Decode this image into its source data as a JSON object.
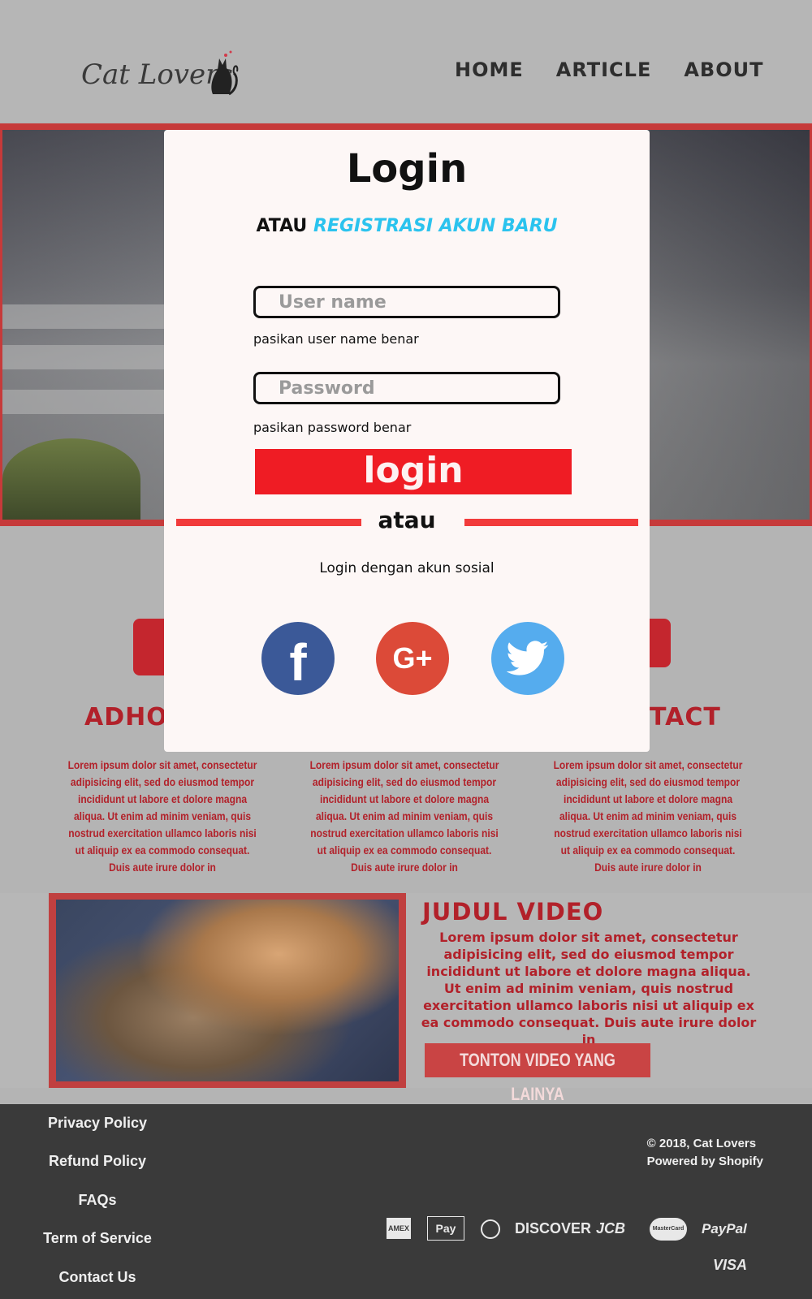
{
  "header": {
    "logo_text": "Cat Lovers",
    "nav": [
      {
        "label": "HOME"
      },
      {
        "label": "ARTICLE"
      },
      {
        "label": "ABOUT"
      }
    ]
  },
  "features": [
    {
      "title": "ADHOP",
      "icon": "github-icon",
      "text": "Lorem ipsum dolor sit amet, consectetur adipisicing elit, sed do eiusmod tempor incididunt ut labore et dolore magna aliqua. Ut enim ad minim veniam, quis nostrud exercitation ullamco laboris nisi ut aliquip ex ea commodo consequat. Duis aute irure dolor in"
    },
    {
      "text": "Lorem ipsum dolor sit amet, consectetur adipisicing elit, sed do eiusmod tempor incididunt ut labore et dolore magna aliqua. Ut enim ad minim veniam, quis nostrud exercitation ullamco laboris nisi ut aliquip ex ea commodo consequat. Duis aute irure dolor in"
    },
    {
      "title": "TACT",
      "icon": "phone-24-icon",
      "text": "Lorem ipsum dolor sit amet, consectetur adipisicing elit, sed do eiusmod tempor incididunt ut labore et dolore magna aliqua. Ut enim ad minim veniam, quis nostrud exercitation ullamco laboris nisi ut aliquip ex ea commodo consequat. Duis aute irure dolor in"
    }
  ],
  "video": {
    "title": "JUDUL VIDEO",
    "text": "Lorem ipsum dolor sit amet, consectetur adipisicing elit, sed do eiusmod tempor incididunt ut labore et dolore magna aliqua. Ut enim ad minim veniam, quis nostrud exercitation ullamco laboris nisi ut aliquip ex ea commodo consequat. Duis aute irure dolor in",
    "button_label": "TONTON VIDEO YANG LAINYA"
  },
  "footer": {
    "links": [
      "Privacy Policy",
      "Refund Policy",
      "FAQs",
      "Term of Service",
      "Contact Us"
    ],
    "copyright": "© 2018, Cat Lovers",
    "powered": "Powered by Shopify",
    "payments": [
      "AMEX",
      "Pay",
      "DISCOVER",
      "JCB",
      "MasterCard",
      "PayPal",
      "VISA"
    ]
  },
  "modal": {
    "title": "Login",
    "register_prefix": "ATAU ",
    "register_link": "REGISTRASI AKUN BARU",
    "username_placeholder": "User name",
    "username_hint": "pasikan user name benar",
    "password_placeholder": "Password",
    "password_hint": "pasikan password benar",
    "login_label": "login",
    "divider_text": "atau",
    "social_text": "Login dengan akun sosial",
    "social": [
      {
        "name": "facebook",
        "glyph": "f",
        "color": "#3b5998"
      },
      {
        "name": "google-plus",
        "glyph": "G+",
        "color": "#dc4a38"
      },
      {
        "name": "twitter",
        "color": "#55acee"
      }
    ]
  },
  "colors": {
    "accent_red": "#c4262e",
    "hero_border": "#c63a3a",
    "login_red": "#ef1c24",
    "register_link": "#2bc3ee",
    "footer_bg": "#3a3a3a"
  }
}
